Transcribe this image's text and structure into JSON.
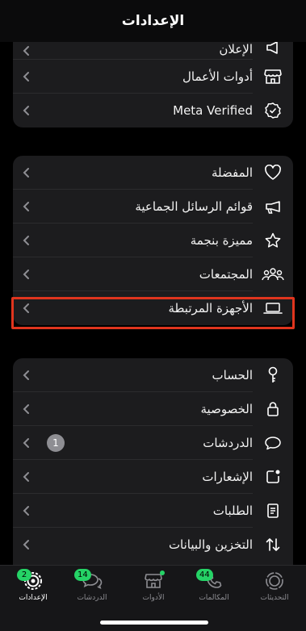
{
  "header": {
    "title": "الإعدادات"
  },
  "group1": {
    "partial_label": "الإعلان",
    "items": [
      {
        "label": "أدوات الأعمال",
        "icon": "store-icon"
      },
      {
        "label": "Meta Verified",
        "icon": "verified-badge-icon"
      }
    ]
  },
  "group2": {
    "items": [
      {
        "label": "المفضلة",
        "icon": "heart-icon"
      },
      {
        "label": "قوائم الرسائل الجماعية",
        "icon": "megaphone-icon"
      },
      {
        "label": "مميزة بنجمة",
        "icon": "star-icon"
      },
      {
        "label": "المجتمعات",
        "icon": "communities-icon"
      },
      {
        "label": "الأجهزة المرتبطة",
        "icon": "laptop-icon"
      }
    ]
  },
  "group3": {
    "items": [
      {
        "label": "الحساب",
        "icon": "key-icon"
      },
      {
        "label": "الخصوصية",
        "icon": "lock-icon"
      },
      {
        "label": "الدردشات",
        "icon": "chat-bubble-icon",
        "badge": "1"
      },
      {
        "label": "الإشعارات",
        "icon": "notification-icon"
      },
      {
        "label": "الطلبات",
        "icon": "requests-doc-icon"
      },
      {
        "label": "التخزين والبيانات",
        "icon": "data-arrows-icon"
      }
    ]
  },
  "tabbar": {
    "tabs": [
      {
        "label": "الإعدادات",
        "icon": "settings-gear-icon",
        "badge": "2",
        "active": true
      },
      {
        "label": "الدردشات",
        "icon": "chats-icon",
        "badge": "14"
      },
      {
        "label": "الأدوات",
        "icon": "tools-store-icon",
        "dot": true
      },
      {
        "label": "المكالمات",
        "icon": "phone-icon",
        "badge": "44"
      },
      {
        "label": "التحديثات",
        "icon": "updates-icon"
      }
    ]
  },
  "colors": {
    "accent_green": "#25d366",
    "highlight_red": "#e0351e",
    "cell_bg": "#1c1c1e"
  }
}
